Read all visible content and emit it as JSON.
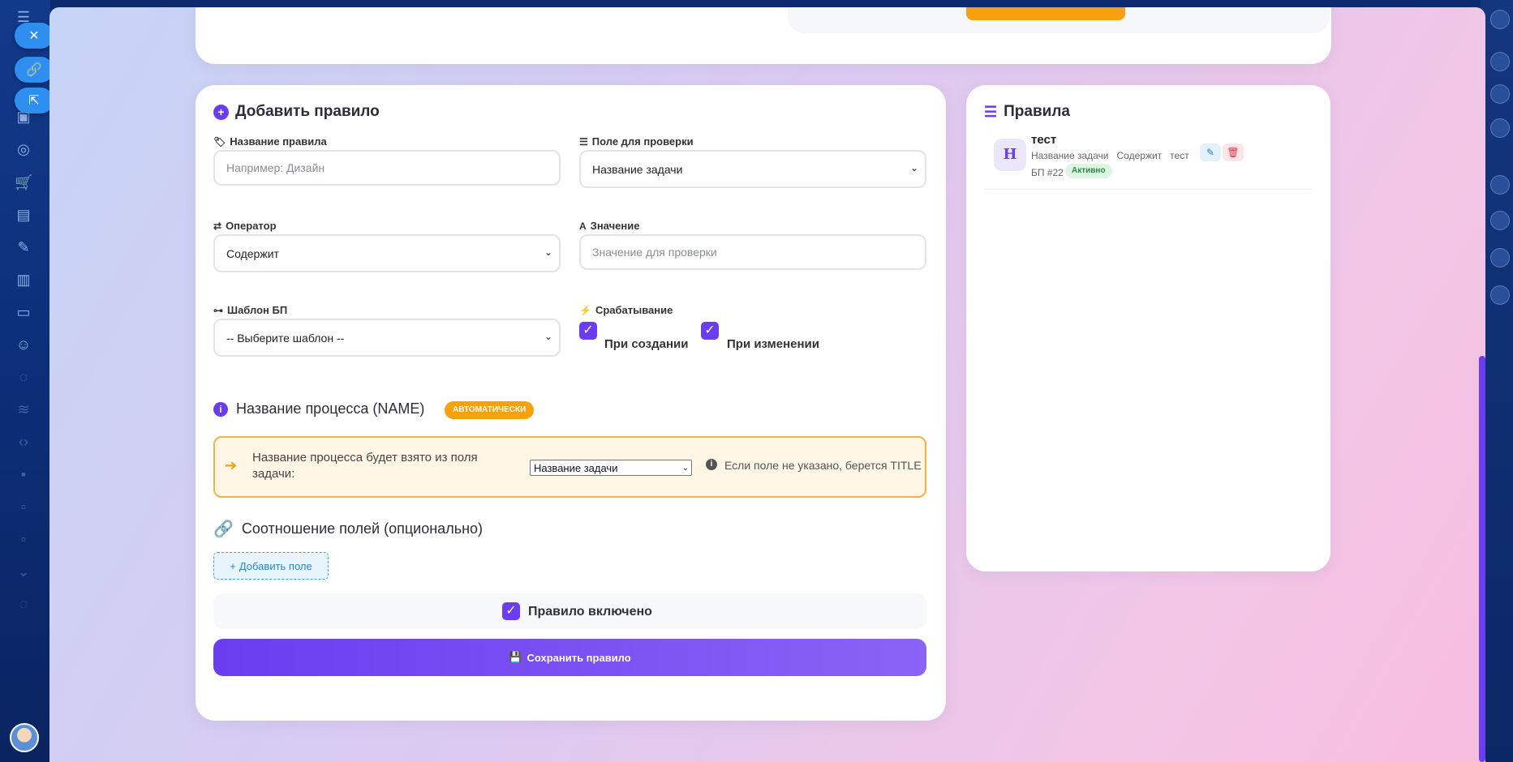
{
  "form": {
    "title": "Добавить правило",
    "rule_name_label": "Название правила",
    "rule_name_placeholder": "Например: Дизайн",
    "check_field_label": "Поле для проверки",
    "check_field_value": "Название задачи",
    "operator_label": "Оператор",
    "operator_value": "Содержит",
    "value_label": "Значение",
    "value_placeholder": "Значение для проверки",
    "template_label": "Шаблон БП",
    "template_value": "-- Выберите шаблон --",
    "trigger_label": "Срабатывание",
    "on_create_label": "При создании",
    "on_change_label": "При изменении",
    "process_name_title": "Название процесса (NAME)",
    "auto_badge": "АВТОМАТИЧЕСКИ",
    "process_notice_text": "Название процесса будет взято из поля задачи:",
    "process_field_value": "Название задачи",
    "process_hint": "Если поле не указано, берется TITLE",
    "mapping_title": "Соотношение полей (опционально)",
    "add_field_label": "Добавить поле",
    "rule_enabled_label": "Правило включено",
    "save_label": "Сохранить правило"
  },
  "rules": {
    "title": "Правила",
    "items": [
      {
        "avatar_letter": "Н",
        "name": "тест",
        "field": "Название задачи",
        "operator": "Содержит",
        "value": "тест",
        "bp": "БП #22",
        "status": "Активно"
      }
    ]
  },
  "colors": {
    "accent": "#6a3df0",
    "warning": "#f7a10f",
    "success_bg": "#dff5e4",
    "danger": "#d93445"
  }
}
